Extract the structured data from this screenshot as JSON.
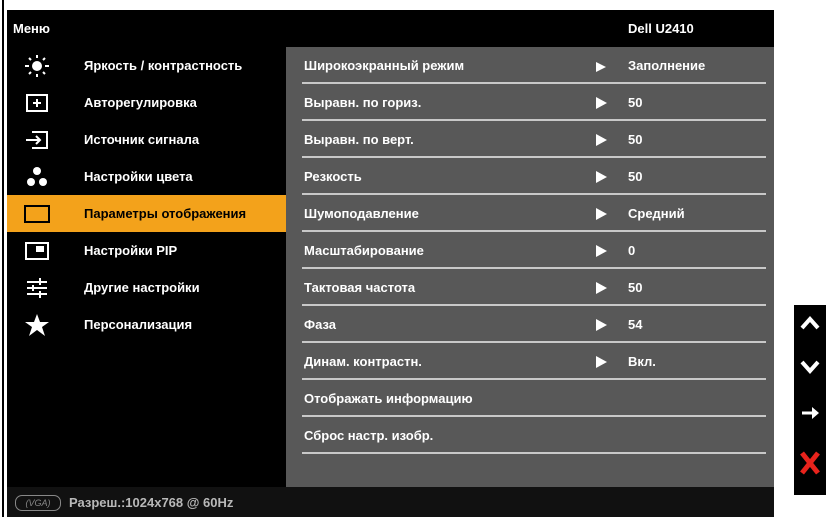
{
  "header": {
    "menu_title": "Меню",
    "model": "Dell U2410"
  },
  "left_menu": [
    {
      "label": "Яркость / контрастность",
      "icon": "brightness-icon"
    },
    {
      "label": "Авторегулировка",
      "icon": "auto-adjust-icon"
    },
    {
      "label": "Источник сигнала",
      "icon": "input-source-icon"
    },
    {
      "label": "Настройки цвета",
      "icon": "color-settings-icon"
    },
    {
      "label": "Параметры отображения",
      "icon": "display-settings-icon",
      "selected": true
    },
    {
      "label": "Настройки PIP",
      "icon": "pip-icon"
    },
    {
      "label": "Другие настройки",
      "icon": "other-settings-icon"
    },
    {
      "label": "Персонализация",
      "icon": "star-icon"
    }
  ],
  "settings": [
    {
      "name": "Широкоэкранный режим",
      "value": "Заполнение"
    },
    {
      "name": "Выравн. по гориз.",
      "value": "50"
    },
    {
      "name": "Выравн. по верт.",
      "value": "50"
    },
    {
      "name": "Резкость",
      "value": "50"
    },
    {
      "name": "Шумоподавление",
      "value": "Средний"
    },
    {
      "name": "Масштабирование",
      "value": "0"
    },
    {
      "name": "Тактовая частота",
      "value": "50"
    },
    {
      "name": "Фаза",
      "value": "54"
    },
    {
      "name": "Динам. контрастн.",
      "value": "Вкл."
    },
    {
      "name": "Отображать информацию"
    },
    {
      "name": "Сброс настр. изобр."
    }
  ],
  "footer": {
    "connector_label": "(VGA)",
    "resolution": "Разреш.:1024x768 @ 60Hz"
  },
  "colors": {
    "accent": "#f3a21b",
    "panel": "#585858",
    "background": "#000000",
    "exit": "#e8231c"
  },
  "side_buttons": [
    "up-icon",
    "down-icon",
    "enter-icon",
    "exit-icon"
  ]
}
